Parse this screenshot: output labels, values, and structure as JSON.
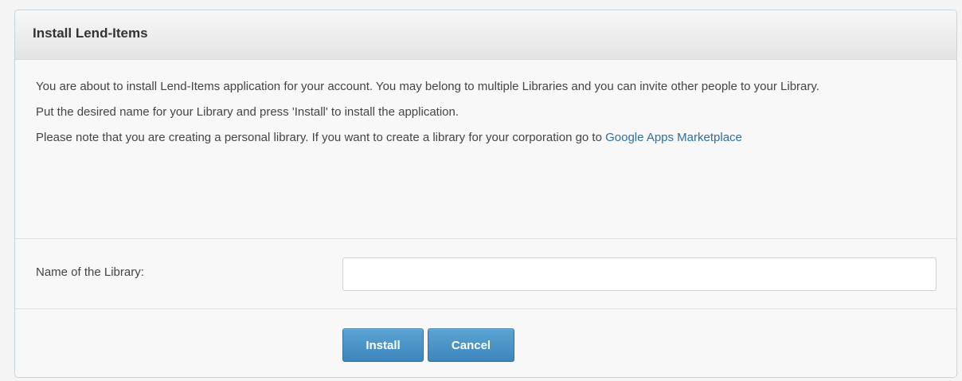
{
  "dialog": {
    "title": "Install Lend-Items",
    "intro_line1": "You are about to install Lend-Items application for your account. You may belong to multiple Libraries and you can invite other people to your Library.",
    "intro_line2": "Put the desired name for your Library and press 'Install' to install the application.",
    "intro_line3_prefix": "Please note that you are creating a personal library. If you want to create a library for your corporation go to ",
    "intro_link": "Google Apps Marketplace"
  },
  "form": {
    "library_name_label": "Name of the Library:",
    "library_name_value": "",
    "library_name_placeholder": ""
  },
  "actions": {
    "install_label": "Install",
    "cancel_label": "Cancel"
  },
  "colors": {
    "button_primary": "#3d86bd",
    "link": "#2f6f9f"
  }
}
